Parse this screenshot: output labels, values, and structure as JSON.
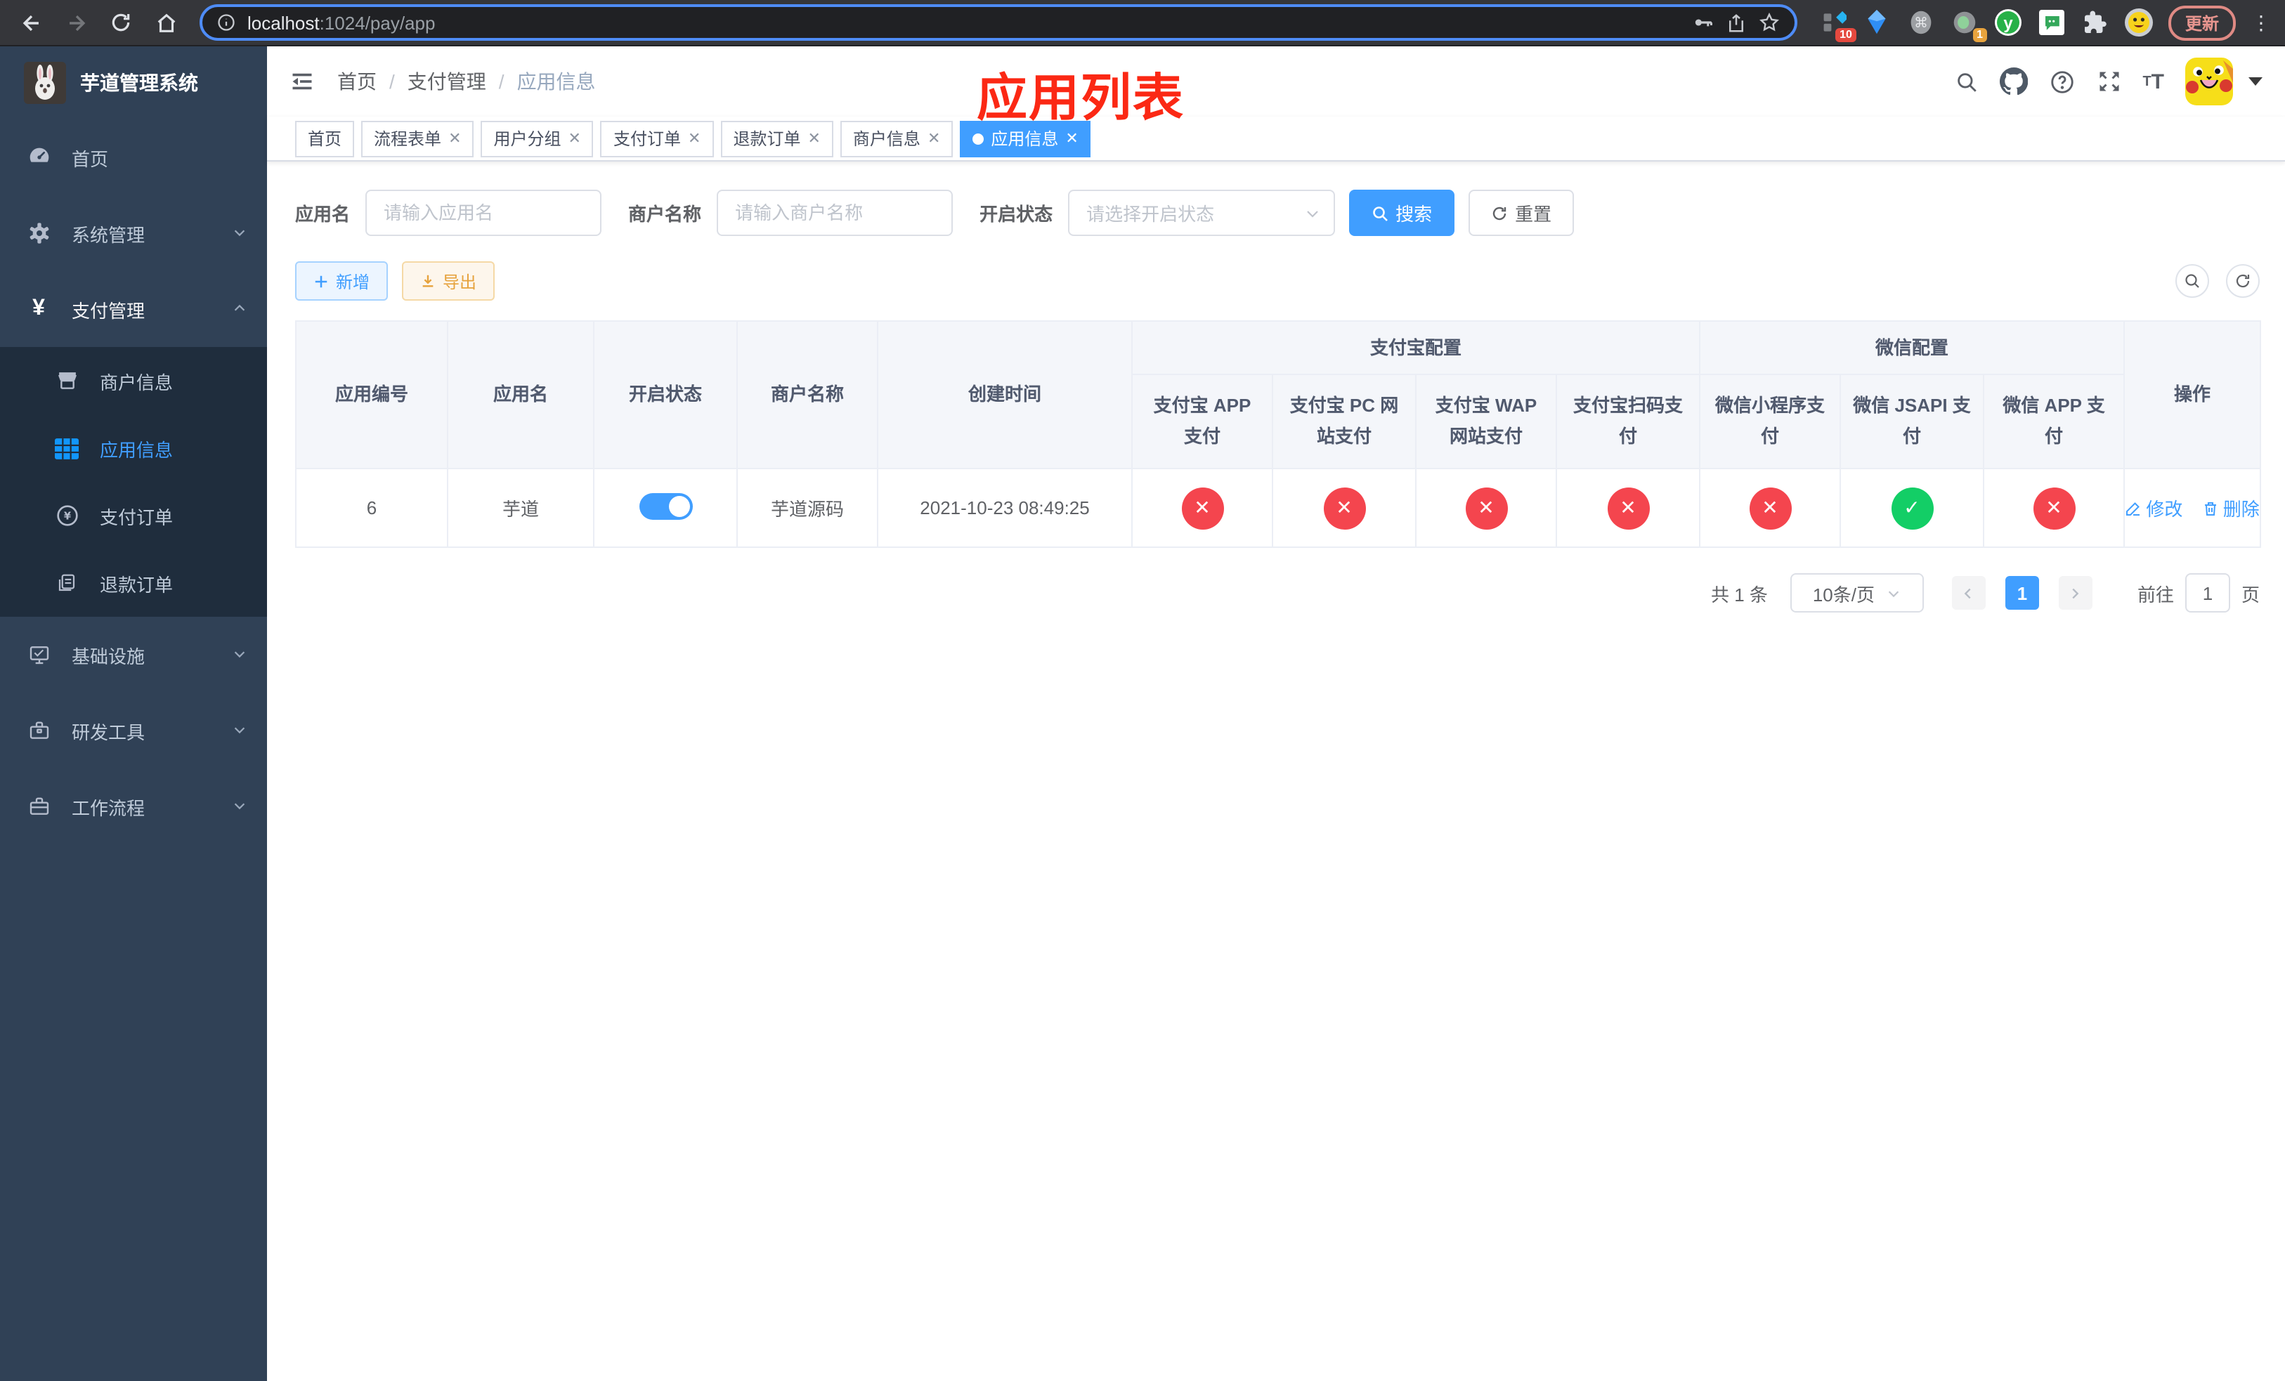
{
  "browser": {
    "url_host": "localhost",
    "url_rest": ":1024/pay/app",
    "ext_badge_grid": "10",
    "ext_badge_circle": "1",
    "ext_y_label": "y",
    "update_label": "更新"
  },
  "sidebar": {
    "title": "芋道管理系统",
    "items": [
      {
        "label": "首页"
      },
      {
        "label": "系统管理"
      },
      {
        "label": "支付管理"
      },
      {
        "label": "基础设施"
      },
      {
        "label": "研发工具"
      },
      {
        "label": "工作流程"
      }
    ],
    "submenu": [
      {
        "label": "商户信息"
      },
      {
        "label": "应用信息"
      },
      {
        "label": "支付订单"
      },
      {
        "label": "退款订单"
      }
    ]
  },
  "navbar": {
    "breadcrumb": [
      {
        "label": "首页"
      },
      {
        "label": "支付管理"
      },
      {
        "label": "应用信息"
      }
    ],
    "annotation": "应用列表"
  },
  "tags": [
    {
      "label": "首页"
    },
    {
      "label": "流程表单"
    },
    {
      "label": "用户分组"
    },
    {
      "label": "支付订单"
    },
    {
      "label": "退款订单"
    },
    {
      "label": "商户信息"
    },
    {
      "label": "应用信息"
    }
  ],
  "filters": {
    "app_name_label": "应用名",
    "app_name_placeholder": "请输入应用名",
    "merchant_label": "商户名称",
    "merchant_placeholder": "请输入商户名称",
    "status_label": "开启状态",
    "status_placeholder": "请选择开启状态",
    "search_label": "搜索",
    "reset_label": "重置"
  },
  "toolbar": {
    "add_label": "新增",
    "export_label": "导出"
  },
  "table": {
    "headers": {
      "app_id": "应用编号",
      "app_name": "应用名",
      "status": "开启状态",
      "merchant": "商户名称",
      "created": "创建时间",
      "alipay_group": "支付宝配置",
      "alipay_cols": [
        "支付宝 APP 支付",
        "支付宝 PC 网站支付",
        "支付宝 WAP 网站支付",
        "支付宝扫码支付"
      ],
      "wechat_group": "微信配置",
      "wechat_cols": [
        "微信小程序支付",
        "微信 JSAPI 支付",
        "微信 APP 支付"
      ],
      "actions": "操作"
    },
    "row": {
      "id": "6",
      "name": "芋道",
      "enabled": true,
      "merchant": "芋道源码",
      "created": "2021-10-23 08:49:25",
      "statuses": [
        false,
        false,
        false,
        false,
        false,
        true,
        false
      ],
      "edit_label": "修改",
      "delete_label": "删除"
    }
  },
  "pagination": {
    "total": "共 1 条",
    "page_size": "10条/页",
    "page": "1",
    "goto_label": "前往",
    "goto_value": "1",
    "page_unit": "页"
  },
  "colors": {
    "accent": "#409eff",
    "danger": "#f4454e",
    "success": "#13ce66",
    "annotation": "#fb2814"
  }
}
